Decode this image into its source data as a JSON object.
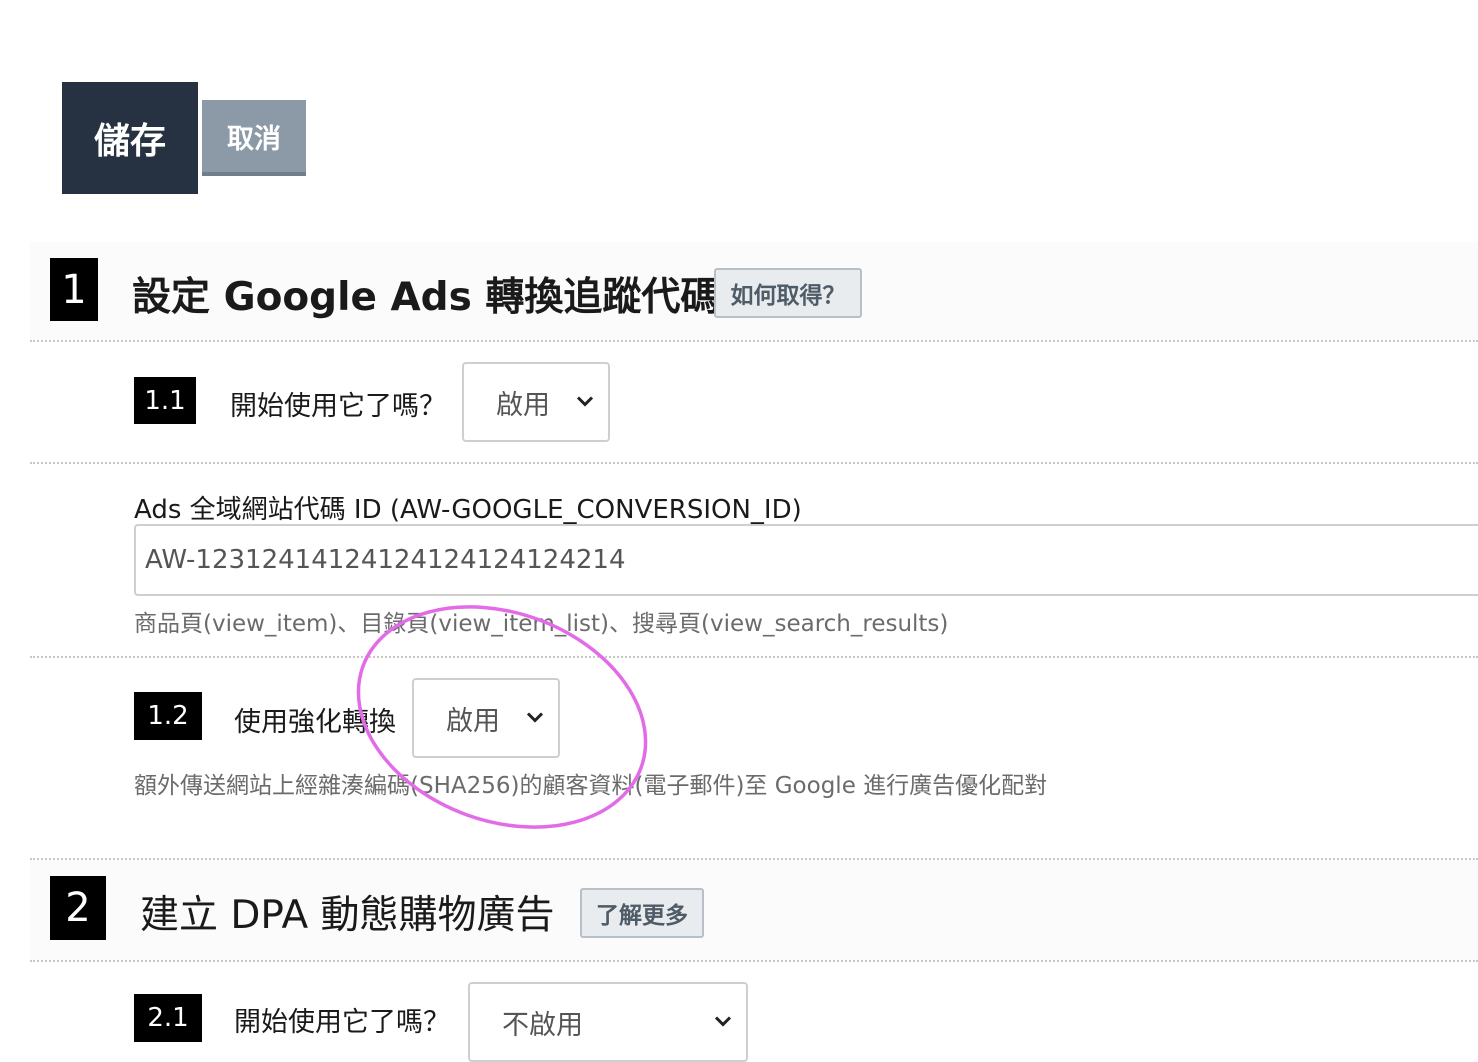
{
  "toolbar": {
    "save_label": "儲存",
    "cancel_label": "取消"
  },
  "section1": {
    "number": "1",
    "title": "設定 Google Ads 轉換追蹤代碼",
    "help_label": "如何取得？",
    "item1": {
      "number": "1.1",
      "label": "開始使用它了嗎？",
      "select_value": "啟用"
    },
    "ads_id": {
      "label": "Ads 全域網站代碼 ID (AW-GOOGLE_CONVERSION_ID)",
      "value": "AW-12312414124124124124124214",
      "hint": "商品頁(view_item)、目錄頁(view_item_list)、搜尋頁(view_search_results)"
    },
    "item2": {
      "number": "1.2",
      "label": "使用強化轉換",
      "select_value": "啟用",
      "hint": "額外傳送網站上經雜湊編碼(SHA256)的顧客資料(電子郵件)至 Google 進行廣告優化配對"
    }
  },
  "section2": {
    "number": "2",
    "title": "建立 DPA 動態購物廣告",
    "help_label": "了解更多",
    "item1": {
      "number": "2.1",
      "label": "開始使用它了嗎？",
      "select_value": "不啟用"
    }
  },
  "colors": {
    "save_bg": "#263242",
    "cancel_bg": "#8c9aa7",
    "annotation_circle": "#e36be8"
  },
  "icons": {
    "select_chevron": "chevron-down-icon"
  }
}
